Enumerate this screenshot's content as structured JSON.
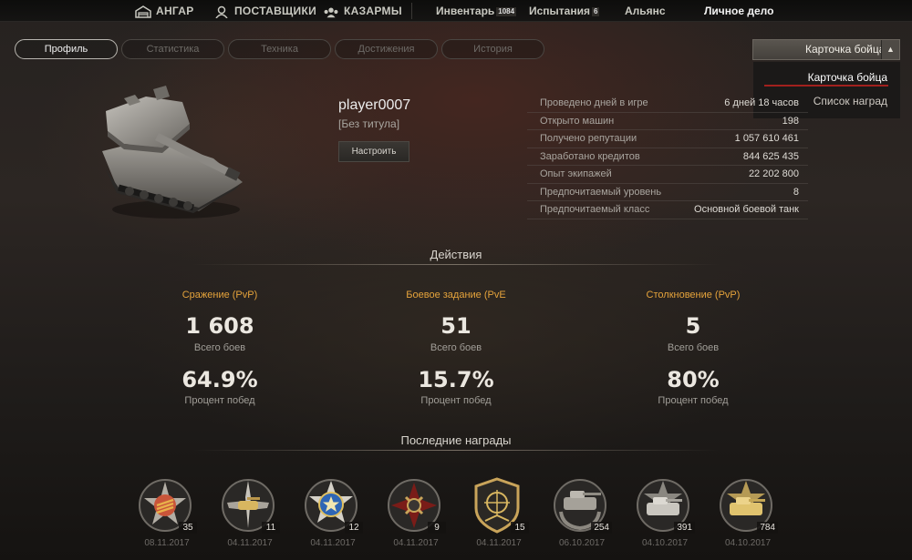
{
  "nav": {
    "hangar": "АНГАР",
    "suppliers": "ПОСТАВЩИКИ",
    "barracks": "КАЗАРМЫ",
    "inventory": "Инвентарь",
    "inventory_count": "1084",
    "trials": "Испытания",
    "trials_count": "6",
    "alliance": "Альянс",
    "personal_file": "Личное дело"
  },
  "tabs": [
    "Профиль",
    "Статистика",
    "Техника",
    "Достижения",
    "История"
  ],
  "dropdown": {
    "selected": "Карточка бойца",
    "items": [
      "Карточка бойца",
      "Список наград"
    ]
  },
  "player": {
    "name": "player0007",
    "title": "[Без титула]",
    "setup_button": "Настроить"
  },
  "stats": [
    {
      "label": "Проведено дней в игре",
      "value": "6 дней 18 часов"
    },
    {
      "label": "Открыто машин",
      "value": "198"
    },
    {
      "label": "Получено репутации",
      "value": "1 057 610 461"
    },
    {
      "label": "Заработано кредитов",
      "value": "844 625 435"
    },
    {
      "label": "Опыт экипажей",
      "value": "22 202 800"
    },
    {
      "label": "Предпочитаемый уровень",
      "value": "8"
    },
    {
      "label": "Предпочитаемый класс",
      "value": "Основной боевой танк"
    }
  ],
  "actions": {
    "heading": "Действия",
    "modes": [
      {
        "title": "Сражение (PvP)",
        "battles": "1 608",
        "battles_label": "Всего боев",
        "winrate": "64.9%",
        "winrate_label": "Процент побед"
      },
      {
        "title": "Боевое задание (PvE",
        "battles": "51",
        "battles_label": "Всего боев",
        "winrate": "15.7%",
        "winrate_label": "Процент побед"
      },
      {
        "title": "Столкновение (PvP)",
        "battles": "5",
        "battles_label": "Всего боев",
        "winrate": "80%",
        "winrate_label": "Процент побед"
      }
    ]
  },
  "awards": {
    "heading": "Последние награды",
    "items": [
      {
        "count": "35",
        "date": "08.11.2017",
        "icon": "star-medal-icon"
      },
      {
        "count": "11",
        "date": "04.11.2017",
        "icon": "winged-tank-medal-icon"
      },
      {
        "count": "12",
        "date": "04.11.2017",
        "icon": "blue-star-medal-icon"
      },
      {
        "count": "9",
        "date": "04.11.2017",
        "icon": "cross-medal-icon"
      },
      {
        "count": "15",
        "date": "04.11.2017",
        "icon": "crosshair-shield-medal-icon"
      },
      {
        "count": "254",
        "date": "06.10.2017",
        "icon": "tank-wreath-medal-icon"
      },
      {
        "count": "391",
        "date": "04.10.2017",
        "icon": "silver-tank-medal-icon"
      },
      {
        "count": "784",
        "date": "04.10.2017",
        "icon": "gold-tank-medal-icon"
      }
    ]
  }
}
